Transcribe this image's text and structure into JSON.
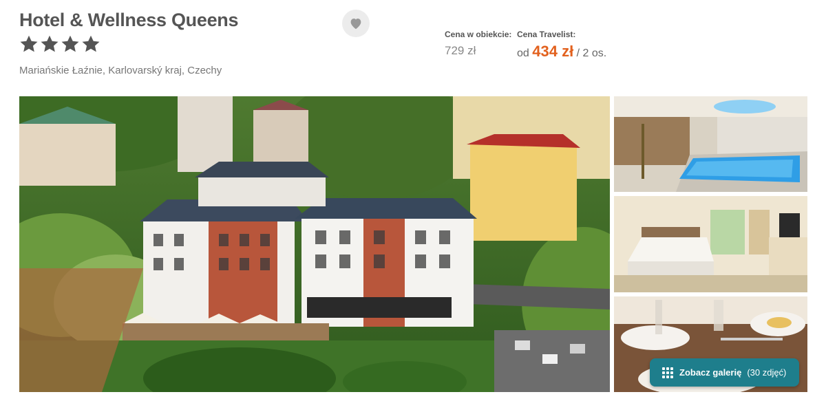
{
  "hotel": {
    "name": "Hotel & Wellness Queens",
    "stars": 4,
    "location": "Mariańskie Łaźnie, Karlovarský kraj, Czechy"
  },
  "prices": {
    "onsite_label": "Cena w obiekcie:",
    "onsite_value": "729 zł",
    "travelist_label": "Cena Travelist:",
    "travelist_prefix": "od",
    "travelist_value": "434 zł",
    "travelist_per": "/ 2 os."
  },
  "gallery": {
    "button_label": "Zobacz galerię",
    "button_count": "(30 zdjęć)"
  },
  "colors": {
    "accent_price": "#e2611e",
    "gallery_button": "#1e7e8c",
    "star": "#555555"
  },
  "icons": {
    "favorite": "heart-icon",
    "gallery": "grid-icon",
    "rating": "star-icon"
  }
}
